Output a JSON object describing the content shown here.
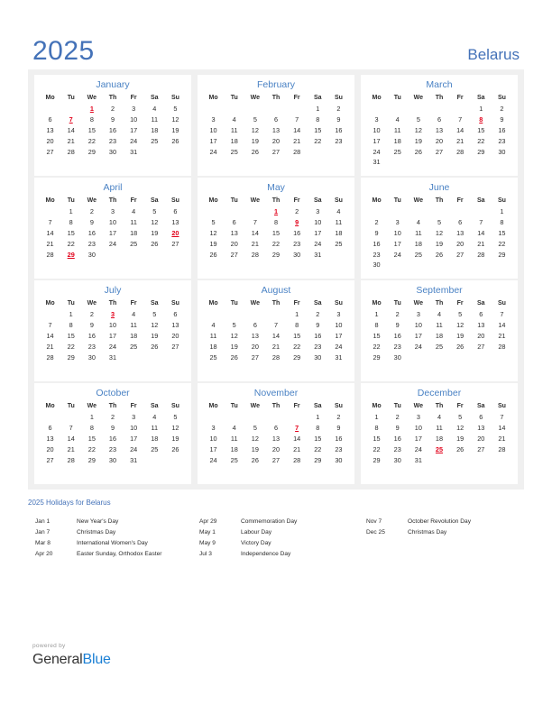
{
  "header": {
    "year": "2025",
    "country": "Belarus",
    "accent_color": "#4472b8"
  },
  "weekday_headers": [
    "Mo",
    "Tu",
    "We",
    "Th",
    "Fr",
    "Sa",
    "Su"
  ],
  "holiday_color": "#e2001a",
  "months": [
    {
      "name": "January",
      "lead_blanks": 2,
      "days": 31,
      "holidays": [
        1,
        7
      ]
    },
    {
      "name": "February",
      "lead_blanks": 5,
      "days": 28,
      "holidays": []
    },
    {
      "name": "March",
      "lead_blanks": 5,
      "days": 31,
      "holidays": [
        8
      ]
    },
    {
      "name": "April",
      "lead_blanks": 1,
      "days": 30,
      "holidays": [
        20,
        29
      ]
    },
    {
      "name": "May",
      "lead_blanks": 3,
      "days": 31,
      "holidays": [
        1,
        9
      ]
    },
    {
      "name": "June",
      "lead_blanks": 6,
      "days": 30,
      "holidays": []
    },
    {
      "name": "July",
      "lead_blanks": 1,
      "days": 31,
      "holidays": [
        3
      ]
    },
    {
      "name": "August",
      "lead_blanks": 4,
      "days": 31,
      "holidays": []
    },
    {
      "name": "September",
      "lead_blanks": 0,
      "days": 30,
      "holidays": []
    },
    {
      "name": "October",
      "lead_blanks": 2,
      "days": 31,
      "holidays": []
    },
    {
      "name": "November",
      "lead_blanks": 5,
      "days": 30,
      "holidays": [
        7
      ]
    },
    {
      "name": "December",
      "lead_blanks": 0,
      "days": 31,
      "holidays": [
        25
      ]
    }
  ],
  "holidays_section": {
    "title": "2025 Holidays for Belarus",
    "columns": [
      [
        {
          "date": "Jan 1",
          "name": "New Year's Day"
        },
        {
          "date": "Jan 7",
          "name": "Christmas Day"
        },
        {
          "date": "Mar 8",
          "name": "International Women's Day"
        },
        {
          "date": "Apr 20",
          "name": "Easter Sunday, Orthodox Easter"
        }
      ],
      [
        {
          "date": "Apr 29",
          "name": "Commemoration Day"
        },
        {
          "date": "May 1",
          "name": "Labour Day"
        },
        {
          "date": "May 9",
          "name": "Victory Day"
        },
        {
          "date": "Jul 3",
          "name": "Independence Day"
        }
      ],
      [
        {
          "date": "Nov 7",
          "name": "October Revolution Day"
        },
        {
          "date": "Dec 25",
          "name": "Christmas Day"
        }
      ]
    ]
  },
  "footer": {
    "powered_by": "powered by",
    "brand_primary": "General",
    "brand_secondary": "Blue"
  }
}
